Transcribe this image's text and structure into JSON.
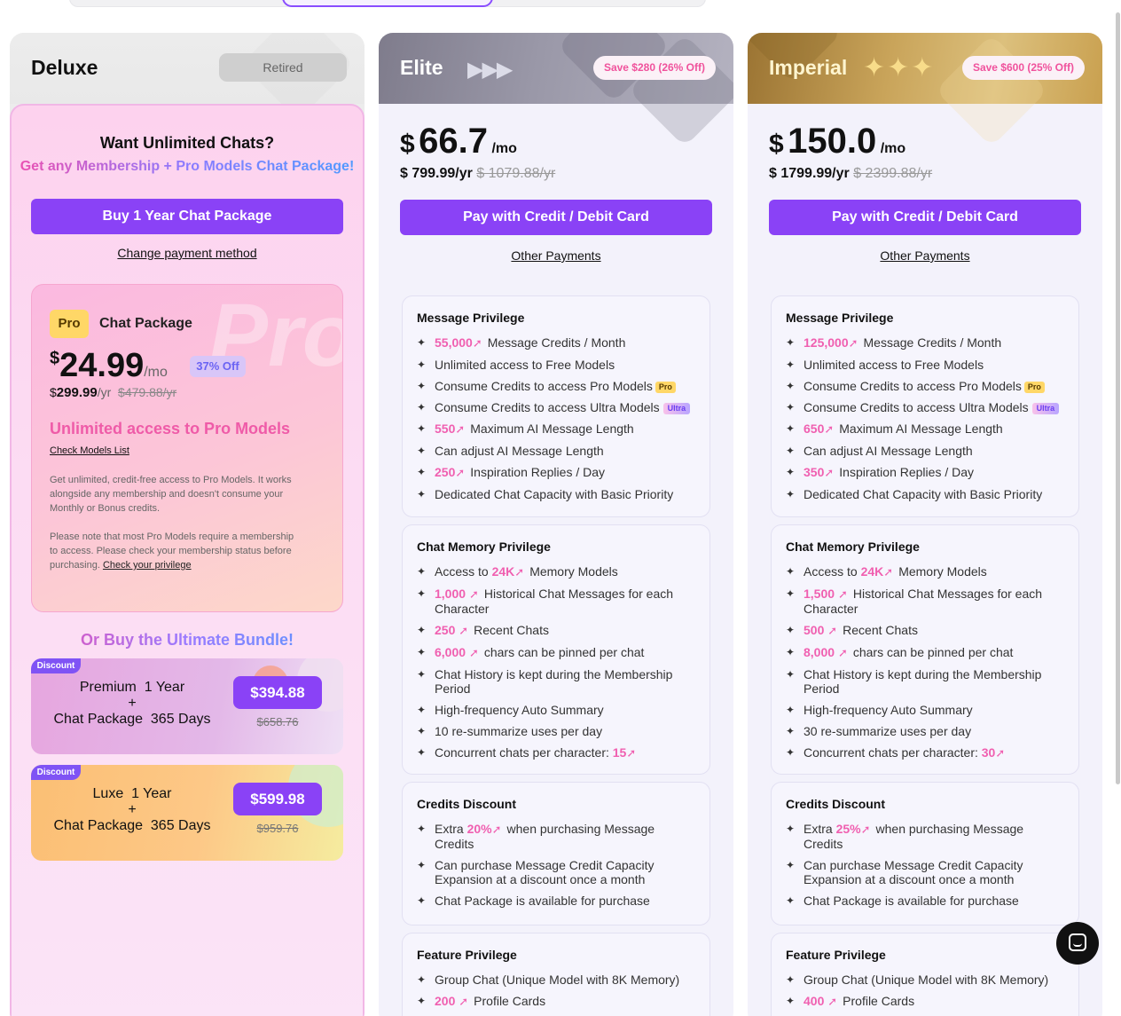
{
  "deluxe": {
    "name": "Deluxe",
    "retired_label": "Retired",
    "want_title": "Want Unlimited Chats?",
    "want_sub": "Get any Membership + Pro Models Chat Package!",
    "buy_button": "Buy 1 Year Chat Package",
    "change_payment": "Change payment method",
    "pro": {
      "tag": "Pro",
      "label": "Chat Package",
      "watermark": "Pro",
      "currency": "$",
      "price": "24.99",
      "per": "/mo",
      "off": "37% Off",
      "year_currency": "$",
      "year_price": "299.99",
      "year_per": "/yr",
      "year_old": "$479.88/yr",
      "unlimited": "Unlimited access to Pro Models",
      "check_models": "Check Models List",
      "desc1": "Get unlimited, credit-free access to Pro Models. It works alongside any membership and doesn't consume your Monthly or Bonus credits.",
      "desc2": "Please note that most Pro Models require a membership to access. Please check your membership status before purchasing.",
      "check_privilege": "Check your privilege"
    },
    "bundle_title": "Or Buy the Ultimate Bundle!",
    "bundles": [
      {
        "tag": "Discount",
        "line1": "Premium  1 Year",
        "plus": "+",
        "line2": "Chat Package  365 Days",
        "price": "$394.88",
        "old": "$658.76"
      },
      {
        "tag": "Discount",
        "line1": "Luxe  1 Year",
        "plus": "+",
        "line2": "Chat Package  365 Days",
        "price": "$599.98",
        "old": "$959.76"
      }
    ]
  },
  "elite": {
    "name": "Elite",
    "save": "Save $280 (26% Off)",
    "currency": "$",
    "price": "66.7",
    "per": "/mo",
    "year": "$ 799.99/yr",
    "year_old": "$ 1079.88/yr",
    "pay_button": "Pay with Credit / Debit Card",
    "other_payments": "Other Payments",
    "message": {
      "title": "Message Privilege",
      "credits": "55,000",
      "credits_text": "Message Credits / Month",
      "free": "Unlimited access to Free Models",
      "pro": "Consume Credits to access Pro Models",
      "pro_tag": "Pro",
      "ultra": "Consume Credits to access Ultra Models",
      "ultra_tag": "Ultra",
      "length": "550",
      "length_text": "Maximum AI Message Length",
      "adjust": "Can adjust AI Message Length",
      "insp": "250",
      "insp_text": "Inspiration Replies / Day",
      "capacity": "Dedicated Chat Capacity with Basic Priority"
    },
    "memory": {
      "title": "Chat Memory Privilege",
      "access_pre": "Access to",
      "access_val": "24K",
      "access_text": "Memory Models",
      "hist_val": "1,000",
      "hist_text": "Historical Chat Messages for each Character",
      "recent_val": "250",
      "recent_text": "Recent Chats",
      "pin_val": "6,000",
      "pin_text": "chars can be pinned per chat",
      "kept": "Chat History is kept during the Membership Period",
      "auto": "High-frequency Auto Summary",
      "resum": "10 re-summarize uses per day",
      "conc_pre": "Concurrent chats per character:",
      "conc_val": "15"
    },
    "credits": {
      "title": "Credits Discount",
      "extra_pre": "Extra",
      "extra_val": "20%",
      "extra_text": "when purchasing Message Credits",
      "expansion": "Can purchase Message Credit Capacity Expansion at a discount once a month",
      "package": "Chat Package is available for purchase"
    },
    "feature": {
      "title": "Feature Privilege",
      "group": "Group Chat (Unique Model with 8K Memory)",
      "profile_val": "200",
      "profile_text": "Profile Cards"
    }
  },
  "imperial": {
    "name": "Imperial",
    "save": "Save $600 (25% Off)",
    "currency": "$",
    "price": "150.0",
    "per": "/mo",
    "year": "$ 1799.99/yr",
    "year_old": "$ 2399.88/yr",
    "pay_button": "Pay with Credit / Debit Card",
    "other_payments": "Other Payments",
    "message": {
      "title": "Message Privilege",
      "credits": "125,000",
      "credits_text": "Message Credits / Month",
      "free": "Unlimited access to Free Models",
      "pro": "Consume Credits to access Pro Models",
      "pro_tag": "Pro",
      "ultra": "Consume Credits to access Ultra Models",
      "ultra_tag": "Ultra",
      "length": "650",
      "length_text": "Maximum AI Message Length",
      "adjust": "Can adjust AI Message Length",
      "insp": "350",
      "insp_text": "Inspiration Replies / Day",
      "capacity": "Dedicated Chat Capacity with Basic Priority"
    },
    "memory": {
      "title": "Chat Memory Privilege",
      "access_pre": "Access to",
      "access_val": "24K",
      "access_text": "Memory Models",
      "hist_val": "1,500",
      "hist_text": "Historical Chat Messages for each Character",
      "recent_val": "500",
      "recent_text": "Recent Chats",
      "pin_val": "8,000",
      "pin_text": "chars can be pinned per chat",
      "kept": "Chat History is kept during the Membership Period",
      "auto": "High-frequency Auto Summary",
      "resum": "30 re-summarize uses per day",
      "conc_pre": "Concurrent chats per character:",
      "conc_val": "30"
    },
    "credits": {
      "title": "Credits Discount",
      "extra_pre": "Extra",
      "extra_val": "25%",
      "extra_text": "when purchasing Message Credits",
      "expansion": "Can purchase Message Credit Capacity Expansion at a discount once a month",
      "package": "Chat Package is available for purchase"
    },
    "feature": {
      "title": "Feature Privilege",
      "group": "Group Chat (Unique Model with 8K Memory)",
      "profile_val": "400",
      "profile_text": "Profile Cards"
    }
  },
  "icons": {
    "bullet": "sparkle-icon",
    "up": "up-arrow-icon",
    "support": "chat-support-icon"
  },
  "colors": {
    "accent": "#8a42f6",
    "highlight": "#f05fb0",
    "pro_tag": "#ffd767"
  }
}
